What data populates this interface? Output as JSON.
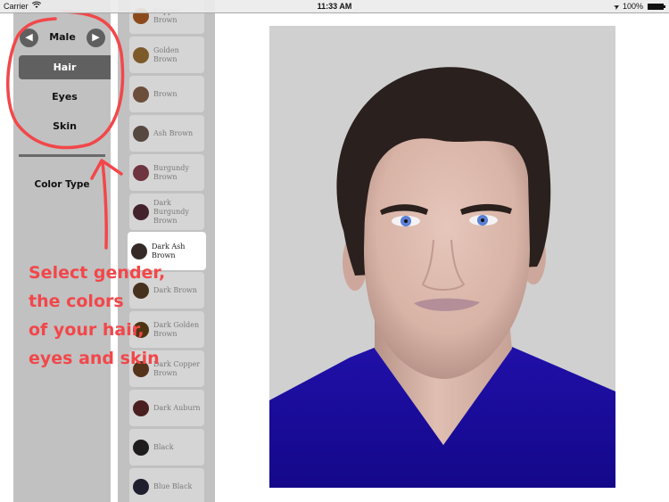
{
  "status_bar": {
    "carrier": "Carrier",
    "time": "11:33 AM",
    "battery": "100%",
    "icons": [
      "wifi-icon",
      "location-arrow-icon",
      "battery-icon"
    ]
  },
  "left_panel": {
    "gender": "Male",
    "prev_icon": "◀",
    "next_icon": "▶",
    "menu": [
      {
        "label": "Hair",
        "active": true
      },
      {
        "label": "Eyes",
        "active": false
      },
      {
        "label": "Skin",
        "active": false
      }
    ],
    "color_type_label": "Color Type"
  },
  "swatches": [
    {
      "label": "Copper Brown",
      "color": "#8c4a1c",
      "selected": false
    },
    {
      "label": "Golden Brown",
      "color": "#7d5a2a",
      "selected": false
    },
    {
      "label": "Brown",
      "color": "#6b4e39",
      "selected": false
    },
    {
      "label": "Ash Brown",
      "color": "#57483f",
      "selected": false
    },
    {
      "label": "Burgundy Brown",
      "color": "#6e3440",
      "selected": false
    },
    {
      "label": "Dark Burgundy Brown",
      "color": "#44222c",
      "selected": false
    },
    {
      "label": "Dark Ash Brown",
      "color": "#352a27",
      "selected": true
    },
    {
      "label": "Dark Brown",
      "color": "#46301e",
      "selected": false
    },
    {
      "label": "Dark Golden Brown",
      "color": "#4e3512",
      "selected": false
    },
    {
      "label": "Dark Copper Brown",
      "color": "#55321a",
      "selected": false
    },
    {
      "label": "Dark Auburn",
      "color": "#4a1f1f",
      "selected": false
    },
    {
      "label": "Black",
      "color": "#1e1c1d",
      "selected": false
    },
    {
      "label": "Blue Black",
      "color": "#1f1f30",
      "selected": false
    }
  ],
  "annotation": {
    "text": "Select gender,\nthe colors\nof your hair,\neyes and skin",
    "color": "#f2474a"
  },
  "portrait": {
    "background": "#d0d0d0",
    "hair_color": "#2a201d",
    "skin_color": "#dcb9ad",
    "eye_color": "#5b7fd6",
    "shirt_color": "#1a0d97"
  }
}
